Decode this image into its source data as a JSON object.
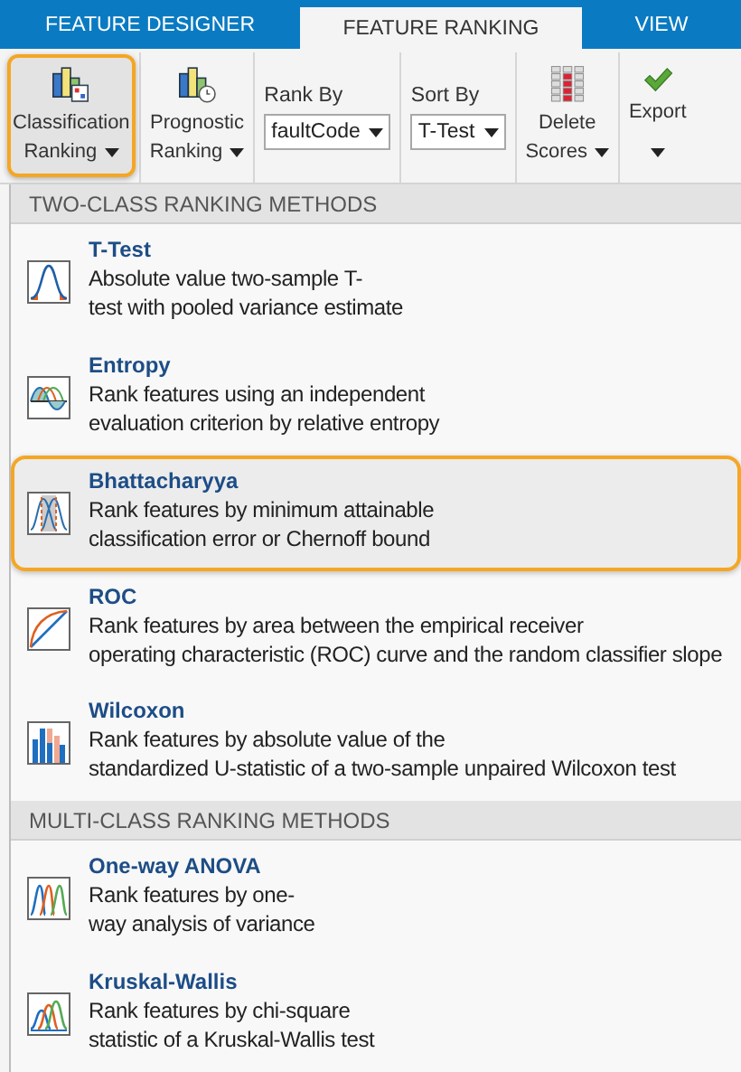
{
  "tabs": [
    {
      "label": "FEATURE DESIGNER",
      "selected": false
    },
    {
      "label": "FEATURE RANKING",
      "selected": true
    },
    {
      "label": "VIEW",
      "selected": false
    }
  ],
  "toolbar": [
    {
      "kind": "button",
      "lines": [
        "Classification",
        "Ranking"
      ],
      "highlighted": true
    },
    {
      "kind": "button",
      "lines": [
        "Prognostic",
        "Ranking"
      ],
      "highlighted": false
    },
    {
      "kind": "dropdown",
      "label": "Rank By",
      "value": "faultCode"
    },
    {
      "kind": "dropdown",
      "label": "Sort By",
      "value": "T-Test"
    },
    {
      "kind": "button",
      "lines": [
        "Delete",
        "Scores"
      ],
      "highlighted": false
    },
    {
      "kind": "button",
      "lines": [
        "Export"
      ],
      "highlighted": false
    }
  ],
  "menu": [
    {
      "header": "TWO-CLASS RANKING METHODS",
      "items": [
        {
          "kind": "bell",
          "title": "T-Test",
          "lines": [
            "Absolute value two-sample T-",
            "test with pooled variance estimate"
          ],
          "selected": false
        },
        {
          "kind": "waves",
          "title": "Entropy",
          "lines": [
            "Rank features using an independent",
            "evaluation criterion by relative entropy"
          ],
          "selected": false
        },
        {
          "kind": "overlap",
          "title": "Bhattacharyya",
          "lines": [
            "Rank features by minimum attainable",
            "classification error or Chernoff bound"
          ],
          "selected": true
        },
        {
          "kind": "curve",
          "title": "ROC",
          "lines": [
            "Rank features by area between the empirical receiver",
            "operating characteristic (ROC) curve and the random classifier slope"
          ],
          "selected": false
        },
        {
          "kind": "bars",
          "title": "Wilcoxon",
          "lines": [
            "Rank features by absolute value of the",
            "standardized U-statistic of a two-sample unpaired Wilcoxon test"
          ],
          "selected": false
        }
      ]
    },
    {
      "header": "MULTI-CLASS RANKING METHODS",
      "items": [
        {
          "kind": "peaks",
          "title": "One-way ANOVA",
          "lines": [
            "Rank features by one-",
            "way analysis of variance"
          ],
          "selected": false
        },
        {
          "kind": "humps",
          "title": "Kruskal-Wallis",
          "lines": [
            "Rank features by chi-square",
            "statistic of a Kruskal-Wallis test"
          ],
          "selected": false
        }
      ]
    }
  ]
}
